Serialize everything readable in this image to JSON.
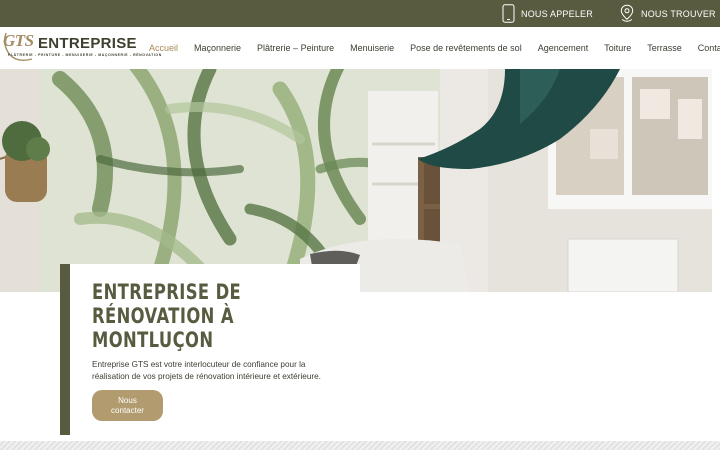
{
  "topbar": {
    "call_label": "NOUS APPELER",
    "find_label": "NOUS TROUVER",
    "background": "#585b3f"
  },
  "logo": {
    "mark": "GTS",
    "wordmark": "ENTREPRISE",
    "tagline": "PLÂTRERIE - PEINTURE - MENUISERIE - MAÇONNERIE - RÉNOVATION"
  },
  "nav": {
    "items": [
      {
        "label": "Accueil",
        "active": true
      },
      {
        "label": "Maçonnerie"
      },
      {
        "label": "Plâtrerie – Peinture"
      },
      {
        "label": "Menuiserie"
      },
      {
        "label": "Pose de revêtements de sol"
      },
      {
        "label": "Agencement"
      },
      {
        "label": "Toiture"
      },
      {
        "label": "Terrasse"
      },
      {
        "label": "Contact"
      }
    ],
    "active_color": "#a88a5a"
  },
  "hero": {
    "image": "bedroom-renovation-photo"
  },
  "intro": {
    "title": "ENTREPRISE DE RÉNOVATION À MONTLUÇON",
    "text": "Entreprise GTS est votre interlocuteur de confiance pour la réalisation de vos projets de rénovation intérieure et extérieure.",
    "button_label": "Nous contacter",
    "accent_color": "#585b3f",
    "button_color": "#b29b6e"
  }
}
